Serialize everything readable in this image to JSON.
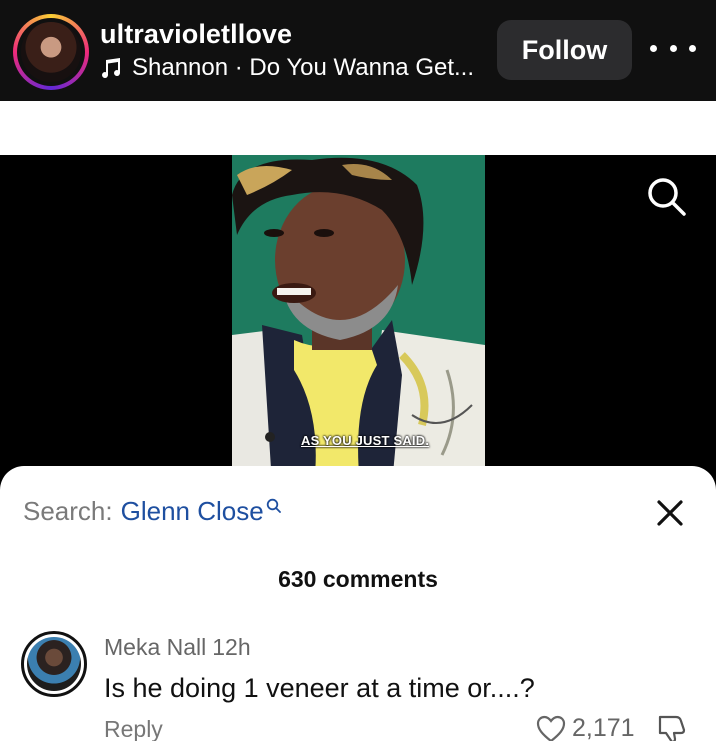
{
  "header": {
    "username": "ultravioletllove",
    "music_text": "Shannon · Do You Wanna Get...",
    "follow_label": "Follow",
    "avatar_icon": "profile-avatar",
    "more_icon": "more-dots-icon",
    "music_icon": "music-note-icon"
  },
  "video": {
    "caption": "AS YOU JUST SAID.",
    "search_icon": "search-icon"
  },
  "comments_sheet": {
    "search_prefix": "Search:",
    "search_term": "Glenn Close",
    "count_text": "630 comments",
    "close_icon": "close-icon",
    "comments": [
      {
        "author": "Meka Nall",
        "time": "12h",
        "text": "Is he doing 1 veneer at a time or....?",
        "reply_label": "Reply",
        "likes": "2,171"
      }
    ]
  },
  "colors": {
    "header_bg": "#101010",
    "follow_bg": "#2c2c2e",
    "search_term": "#1e4fa0",
    "sheet_bg": "#ffffff"
  }
}
